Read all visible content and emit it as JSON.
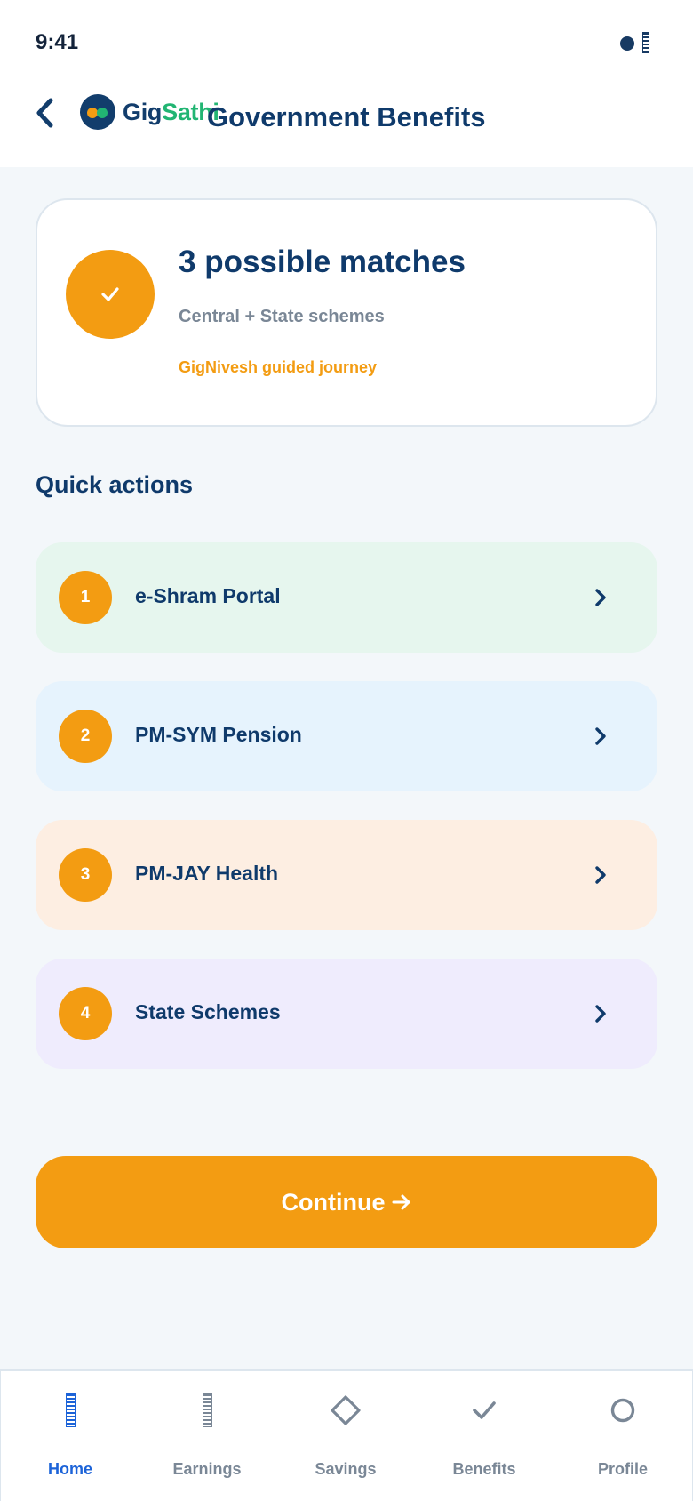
{
  "status_bar": {
    "time": "9:41"
  },
  "header": {
    "brand_gig": "Gig",
    "brand_sathi": "Sathi",
    "title": "Government Benefits"
  },
  "summary": {
    "title": "3 possible matches",
    "subtitle": "Central + State schemes",
    "journey": "GigNivesh guided journey"
  },
  "quick_actions": {
    "title": "Quick actions",
    "items": [
      {
        "number": "1",
        "label": "e-Shram Portal",
        "color": "#e6f6ee"
      },
      {
        "number": "2",
        "label": "PM-SYM Pension",
        "color": "#e6f3fd"
      },
      {
        "number": "3",
        "label": "PM-JAY Health",
        "color": "#fdeee2"
      },
      {
        "number": "4",
        "label": "State Schemes",
        "color": "#efecfd"
      }
    ]
  },
  "continue_label": "Continue",
  "nav": {
    "items": [
      {
        "label": "Home",
        "icon": "bars-icon",
        "active": true
      },
      {
        "label": "Earnings",
        "icon": "bars-icon",
        "active": false
      },
      {
        "label": "Savings",
        "icon": "diamond-icon",
        "active": false
      },
      {
        "label": "Benefits",
        "icon": "check-icon",
        "active": false
      },
      {
        "label": "Profile",
        "icon": "circle-icon",
        "active": false
      }
    ]
  },
  "colors": {
    "accent": "#f39c12",
    "navy": "#0f3a6b",
    "brand_green": "#22b573",
    "active_nav": "#1c63d8",
    "muted": "#7a8796",
    "background": "#f3f7fa"
  }
}
